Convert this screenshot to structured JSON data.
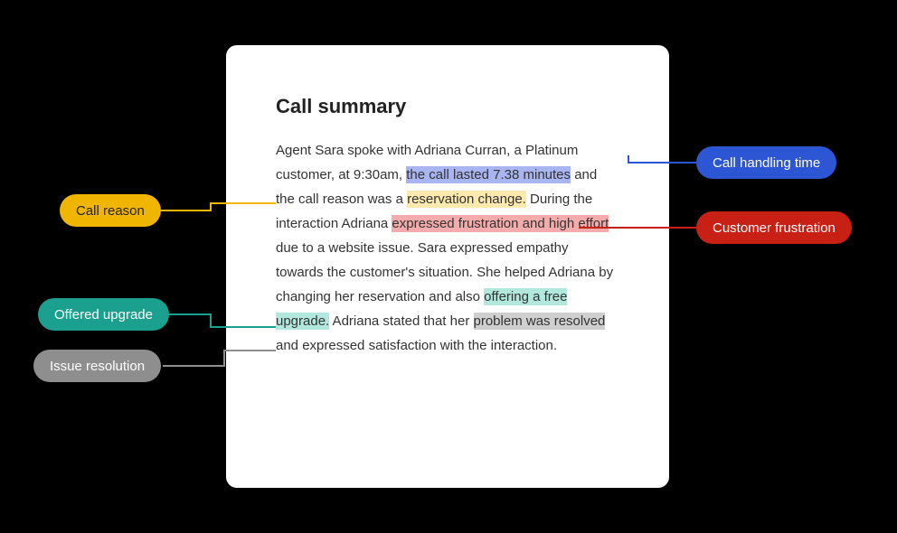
{
  "title": "Call summary",
  "text": {
    "t1": "Agent Sara spoke with Adriana Curran, a Platinum customer, at 9:30am, ",
    "h_blue": "the call lasted 7.38 minutes",
    "t2": " and the call reason was a ",
    "h_yellow": "reservation change.",
    "t3": " During the interaction Adriana ",
    "h_red": "expressed frustration and high effort",
    "t4": " due to a website issue. Sara expressed empathy towards the customer's situation. She helped Adriana by changing her reservation and also ",
    "h_teal": "offering a free upgrade.",
    "t5": " Adriana stated that her ",
    "h_gray": "problem was resolved",
    "t6": " and expressed satisfaction with the interaction."
  },
  "pills": {
    "blue": "Call handling time",
    "yellow": "Call reason",
    "red": "Customer frustration",
    "teal": "Offered upgrade",
    "gray": "Issue resolution"
  },
  "colors": {
    "blue": "#2c56d4",
    "yellow": "#f0b500",
    "red": "#c82015",
    "teal": "#1ba090",
    "gray": "#8e8e8e"
  }
}
